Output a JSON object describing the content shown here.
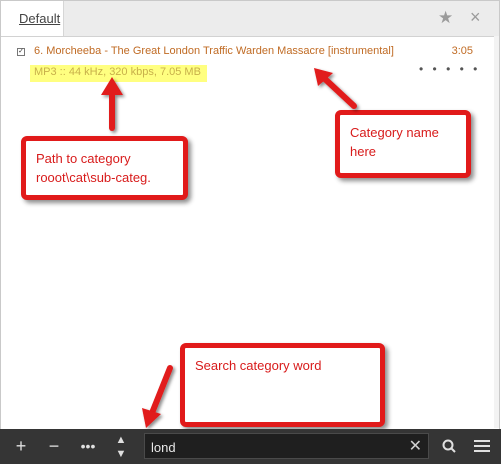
{
  "tabs": [
    {
      "label": "Default"
    }
  ],
  "track": {
    "title": "6. Morcheeba - The Great London Traffic Warden Massacre [instrumental]",
    "duration": "3:05",
    "info": "MP3 :: 44 kHz, 320 kbps, 7.05 MB",
    "rating_dots": "• • • • •"
  },
  "callouts": {
    "path": "Path to category\nrooot\\cat\\sub-categ.",
    "category": "Category name\nhere",
    "search": "Search category word"
  },
  "search": {
    "value": "lond"
  },
  "icons": [
    "star-icon",
    "close-icon",
    "checkbox-icon",
    "plus-icon",
    "minus-icon",
    "more-icon",
    "sort-icon",
    "clear-icon",
    "search-icon",
    "menu-icon"
  ],
  "colors": {
    "accent": "#c06b24",
    "highlight": "#ffff80",
    "callout": "#e11a1a",
    "toolbar": "#353535"
  }
}
